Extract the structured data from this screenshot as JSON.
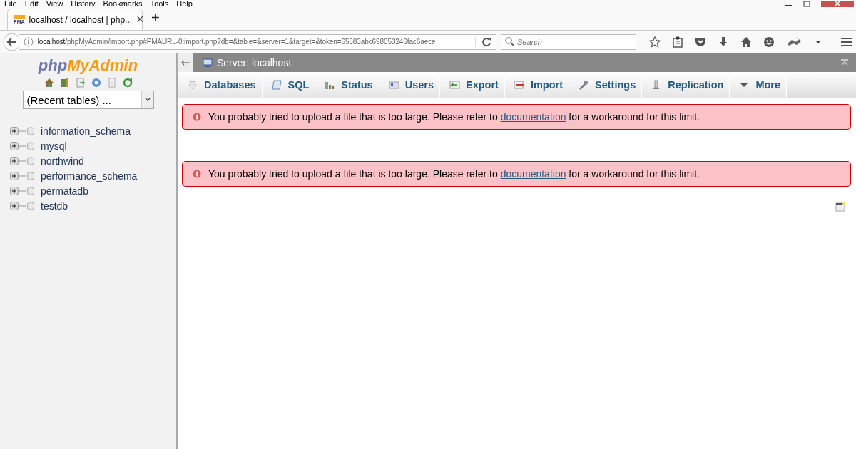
{
  "menu_bar": [
    "File",
    "Edit",
    "View",
    "History",
    "Bookmarks",
    "Tools",
    "Help"
  ],
  "browser_tab": {
    "title": "localhost / localhost | php...",
    "favicon_text": "PMA",
    "close": "×"
  },
  "new_tab": "+",
  "address_bar": {
    "host": "localhost",
    "path": "/phpMyAdmin/import.php#PMAURL-0:import.php?db=&table=&server=1&target=&token=65583abc698053246fac6aece"
  },
  "search": {
    "placeholder": "Search"
  },
  "sidebar": {
    "logo_php": "php",
    "logo_rest": "MyAdmin",
    "recent_tables": "(Recent tables) ...",
    "databases": [
      {
        "name": "information_schema",
        "expanded": false
      },
      {
        "name": "mysql",
        "expanded": false
      },
      {
        "name": "northwind",
        "expanded": false
      },
      {
        "name": "performance_schema",
        "expanded": false
      },
      {
        "name": "permatadb",
        "expanded": false
      },
      {
        "name": "testdb",
        "expanded": false
      }
    ]
  },
  "server_bar": {
    "title": "Server: localhost"
  },
  "tabs": [
    {
      "label": "Databases",
      "kind": "db",
      "selected": false
    },
    {
      "label": "SQL",
      "kind": "sql",
      "selected": false
    },
    {
      "label": "Status",
      "kind": "status",
      "selected": false
    },
    {
      "label": "Users",
      "kind": "users",
      "selected": false
    },
    {
      "label": "Export",
      "kind": "export",
      "selected": false
    },
    {
      "label": "Import",
      "kind": "import",
      "selected": false
    },
    {
      "label": "Settings",
      "kind": "settings",
      "selected": false
    },
    {
      "label": "Replication",
      "kind": "replication",
      "selected": false
    },
    {
      "label": "More",
      "kind": "more",
      "selected": false
    }
  ],
  "errors": [
    {
      "before": "You probably tried to upload a file that is too large. Please refer to",
      "link": "documentation",
      "after": "for a workaround for this limit."
    },
    {
      "before": "You probably tried to upload a file that is too large. Please refer to",
      "link": "documentation",
      "after": "for a workaround for this limit."
    }
  ]
}
